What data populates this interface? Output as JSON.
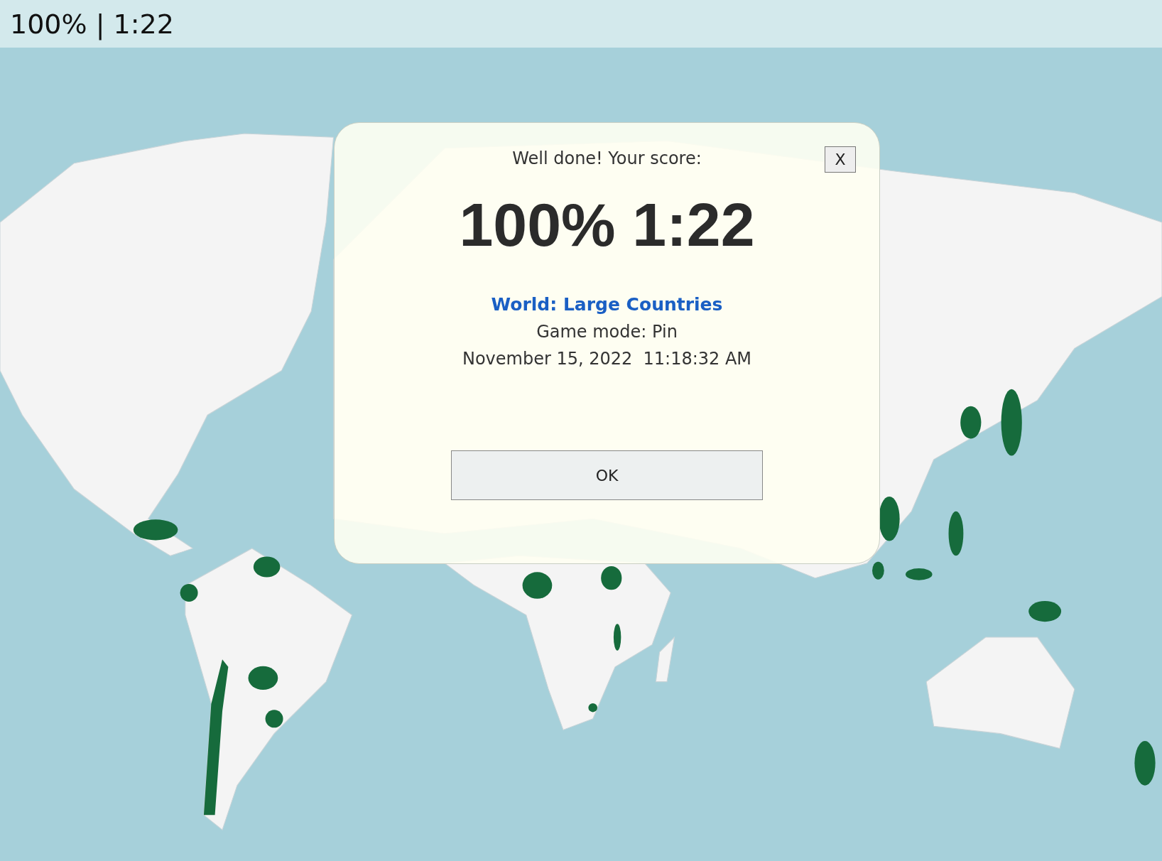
{
  "status_bar": {
    "text": "100% | 1:22"
  },
  "dialog": {
    "title": "Well done! Your score:",
    "close_button": "X",
    "score": "100% 1:22",
    "quiz_link": "World: Large Countries",
    "game_mode": "Game mode: Pin",
    "date": "November 15, 2022  11:18:32 AM",
    "ok_button": "OK"
  }
}
